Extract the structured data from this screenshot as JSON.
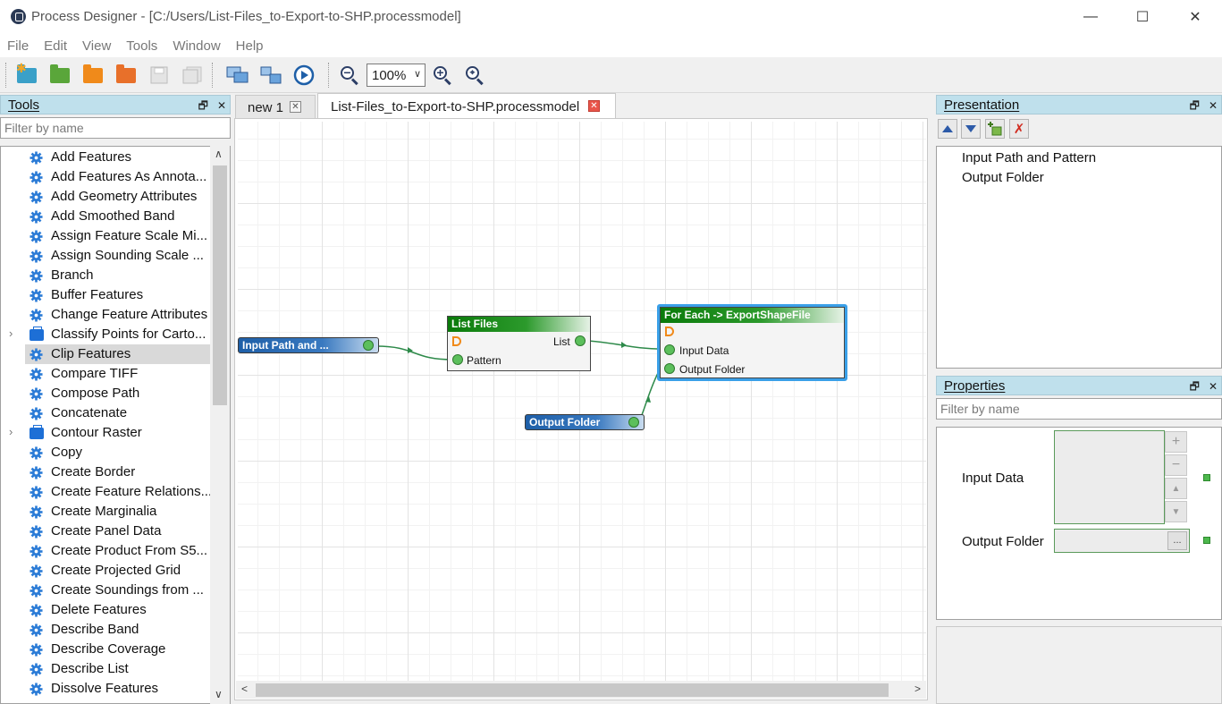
{
  "window": {
    "title": "Process Designer - [C:/Users/List-Files_to-Export-to-SHP.processmodel]",
    "minimize": "—",
    "maximize": "☐",
    "close": "✕"
  },
  "menu": [
    "File",
    "Edit",
    "View",
    "Tools",
    "Window",
    "Help"
  ],
  "toolbar": {
    "zoom_value": "100%"
  },
  "tools_panel": {
    "title": "Tools",
    "filter_placeholder": "Filter by name",
    "items": [
      {
        "label": "Add Features",
        "kind": "tool"
      },
      {
        "label": "Add Features As Annota...",
        "kind": "tool"
      },
      {
        "label": "Add Geometry Attributes",
        "kind": "tool"
      },
      {
        "label": "Add Smoothed Band",
        "kind": "tool"
      },
      {
        "label": "Assign Feature Scale Mi...",
        "kind": "tool"
      },
      {
        "label": "Assign Sounding Scale ...",
        "kind": "tool"
      },
      {
        "label": "Branch",
        "kind": "tool"
      },
      {
        "label": "Buffer Features",
        "kind": "tool"
      },
      {
        "label": "Change Feature Attributes",
        "kind": "tool"
      },
      {
        "label": "Classify Points for Carto...",
        "kind": "toolbox"
      },
      {
        "label": "Clip Features",
        "kind": "tool",
        "selected": true
      },
      {
        "label": "Compare TIFF",
        "kind": "tool"
      },
      {
        "label": "Compose Path",
        "kind": "tool"
      },
      {
        "label": "Concatenate",
        "kind": "tool"
      },
      {
        "label": "Contour Raster",
        "kind": "toolbox"
      },
      {
        "label": "Copy",
        "kind": "tool"
      },
      {
        "label": "Create Border",
        "kind": "tool"
      },
      {
        "label": "Create Feature Relations...",
        "kind": "tool"
      },
      {
        "label": "Create Marginalia",
        "kind": "tool"
      },
      {
        "label": "Create Panel Data",
        "kind": "tool"
      },
      {
        "label": "Create Product From S5...",
        "kind": "tool"
      },
      {
        "label": "Create Projected Grid",
        "kind": "tool"
      },
      {
        "label": "Create Soundings from ...",
        "kind": "tool"
      },
      {
        "label": "Delete Features",
        "kind": "tool"
      },
      {
        "label": "Describe Band",
        "kind": "tool"
      },
      {
        "label": "Describe Coverage",
        "kind": "tool"
      },
      {
        "label": "Describe List",
        "kind": "tool"
      },
      {
        "label": "Dissolve Features",
        "kind": "tool"
      }
    ]
  },
  "editor": {
    "tabs": [
      {
        "label": "new 1"
      },
      {
        "label": "List-Files_to-Export-to-SHP.processmodel",
        "active": true
      }
    ],
    "nodes": {
      "input_param": {
        "label": "Input Path and ..."
      },
      "output_param": {
        "label": "Output Folder"
      },
      "list_files": {
        "title": "List Files",
        "out_port": "List",
        "in_port": "Pattern"
      },
      "for_each": {
        "title": "For Each -> ExportShapeFile",
        "in_port_1": "Input Data",
        "in_port_2": "Output Folder"
      }
    }
  },
  "presentation_panel": {
    "title": "Presentation",
    "items": [
      "Input Path and Pattern",
      "Output Folder"
    ]
  },
  "properties_panel": {
    "title": "Properties",
    "filter_placeholder": "Filter by name",
    "fields": [
      {
        "label": "Input Data"
      },
      {
        "label": "Output Folder",
        "browse_label": "..."
      }
    ]
  },
  "colors": {
    "panel_header": "#bfe0ec",
    "param_node": "#1e5fa8",
    "process_header": "#0a7a0a",
    "selection_border": "#3aa0e8",
    "port": "#5cbf5c"
  }
}
